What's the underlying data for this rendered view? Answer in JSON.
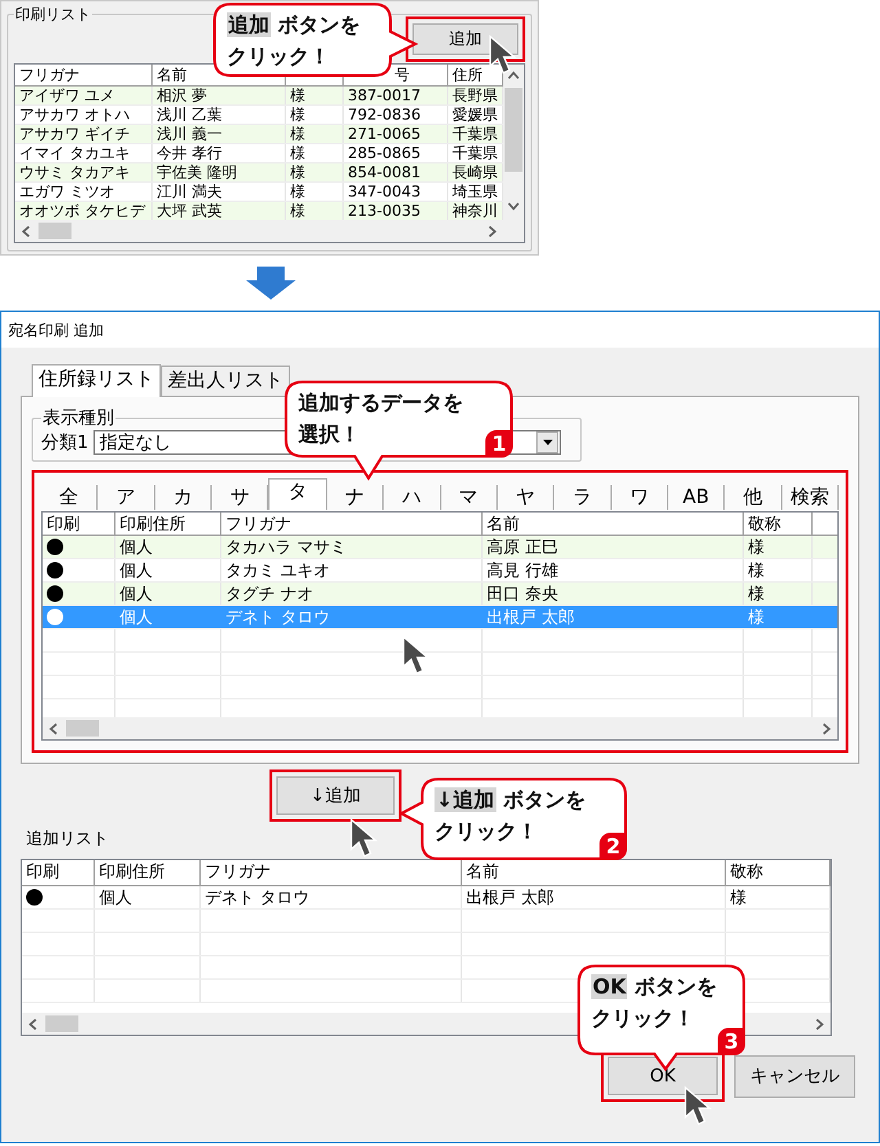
{
  "print_list_window": {
    "group_label": "印刷リスト",
    "add_button": "追加",
    "columns": [
      {
        "label": "フリガナ"
      },
      {
        "label": "名前"
      },
      {},
      {
        "label": "号"
      },
      {
        "label": "住所"
      }
    ],
    "rows": [
      {
        "furigana": "アイザワ ユメ",
        "name": "相沢 夢",
        "honorific": "様",
        "postal_code": "387-0017",
        "address": "長野県"
      },
      {
        "furigana": "アサカワ オトハ",
        "name": "浅川 乙葉",
        "honorific": "様",
        "postal_code": "792-0836",
        "address": "愛媛県"
      },
      {
        "furigana": "アサカワ ギイチ",
        "name": "浅川 義一",
        "honorific": "様",
        "postal_code": "271-0065",
        "address": "千葉県"
      },
      {
        "furigana": "イマイ タカユキ",
        "name": "今井 孝行",
        "honorific": "様",
        "postal_code": "285-0865",
        "address": "千葉県"
      },
      {
        "furigana": "ウサミ タカアキ",
        "name": "宇佐美 隆明",
        "honorific": "様",
        "postal_code": "854-0081",
        "address": "長崎県"
      },
      {
        "furigana": "エガワ ミツオ",
        "name": "江川 満夫",
        "honorific": "様",
        "postal_code": "347-0043",
        "address": "埼玉県"
      },
      {
        "furigana": "オオツボ タケヒデ",
        "name": "大坪 武英",
        "honorific": "様",
        "postal_code": "213-0035",
        "address": "神奈川"
      }
    ]
  },
  "dialog": {
    "title": "宛名印刷 追加",
    "tabs": [
      {
        "label": "住所録リスト",
        "selected": true
      },
      {
        "label": "差出人リスト",
        "selected": false
      }
    ],
    "display_type": {
      "group_label": "表示種別",
      "field_label": "分類1",
      "value": "指定なし"
    },
    "kana_tabs": [
      {
        "label": "全",
        "selected": false
      },
      {
        "label": "ア",
        "selected": false
      },
      {
        "label": "カ",
        "selected": false
      },
      {
        "label": "サ",
        "selected": false
      },
      {
        "label": "タ",
        "selected": true
      },
      {
        "label": "ナ",
        "selected": false
      },
      {
        "label": "ハ",
        "selected": false
      },
      {
        "label": "マ",
        "selected": false
      },
      {
        "label": "ヤ",
        "selected": false
      },
      {
        "label": "ラ",
        "selected": false
      },
      {
        "label": "ワ",
        "selected": false
      },
      {
        "label": "AB",
        "selected": false
      },
      {
        "label": "他",
        "selected": false
      },
      {
        "label": "検索",
        "selected": false
      }
    ],
    "address_list": {
      "columns": [
        "印刷",
        "印刷住所",
        "フリガナ",
        "名前",
        "敬称"
      ],
      "rows": [
        {
          "print": true,
          "address_type": "個人",
          "furigana": "タカハラ マサミ",
          "name": "高原 正巳",
          "honorific": "様",
          "selected": false
        },
        {
          "print": true,
          "address_type": "個人",
          "furigana": "タカミ ユキオ",
          "name": "高見 行雄",
          "honorific": "様",
          "selected": false
        },
        {
          "print": true,
          "address_type": "個人",
          "furigana": "タグチ ナオ",
          "name": "田口 奈央",
          "honorific": "様",
          "selected": false
        },
        {
          "print": true,
          "address_type": "個人",
          "furigana": "デネト タロウ",
          "name": "出根戸 太郎",
          "honorific": "様",
          "selected": true
        }
      ]
    },
    "add_down_button": "↓追加",
    "added_list": {
      "label": "追加リスト",
      "columns": [
        "印刷",
        "印刷住所",
        "フリガナ",
        "名前",
        "敬称"
      ],
      "rows": [
        {
          "print": true,
          "address_type": "個人",
          "furigana": "デネト タロウ",
          "name": "出根戸 太郎",
          "honorific": "様"
        }
      ]
    },
    "ok_button": "OK",
    "cancel_button": "キャンセル"
  },
  "callouts": [
    {
      "key": "追加",
      "lines": [
        "ボタンを",
        "クリック！"
      ]
    },
    {
      "lines": [
        "追加するデータを",
        "選択！"
      ],
      "number": "1"
    },
    {
      "key": "↓追加",
      "lines": [
        "ボタンを",
        "クリック！"
      ],
      "number": "2"
    },
    {
      "key": "OK",
      "lines": [
        "ボタンを",
        "クリック！"
      ],
      "number": "3"
    }
  ]
}
